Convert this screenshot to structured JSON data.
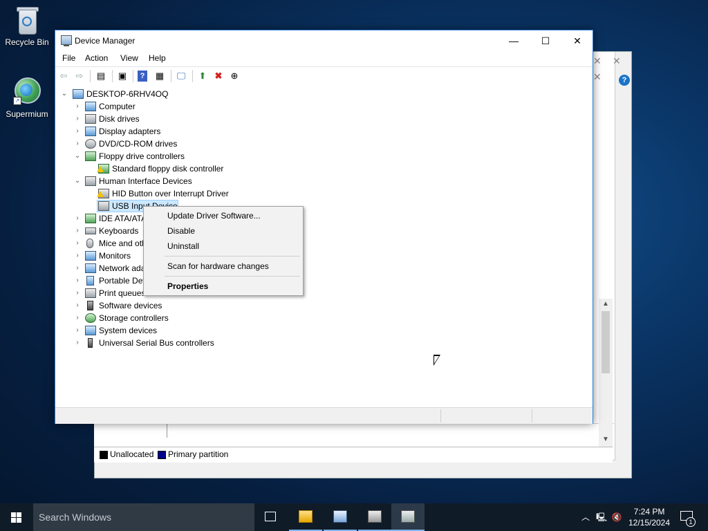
{
  "desktop": {
    "icons": [
      {
        "label": "Recycle Bin",
        "icon": "recycle-bin-icon"
      },
      {
        "label": "Supermium",
        "icon": "supermium-browser-icon"
      }
    ]
  },
  "background_window": {
    "legend": [
      {
        "label": "Unallocated",
        "color": "#000000"
      },
      {
        "label": "Primary partition",
        "color": "#00008b"
      }
    ]
  },
  "device_manager": {
    "title": "Device Manager",
    "controls": {
      "minimize": "—",
      "maximize": "☐",
      "close": "✕"
    },
    "menu": [
      "File",
      "Action",
      "View",
      "Help"
    ],
    "tree": {
      "root": "DESKTOP-6RHV4OQ",
      "categories": [
        {
          "label": "Computer",
          "expanded": false
        },
        {
          "label": "Disk drives",
          "expanded": false
        },
        {
          "label": "Display adapters",
          "expanded": false
        },
        {
          "label": "DVD/CD-ROM drives",
          "expanded": false
        },
        {
          "label": "Floppy drive controllers",
          "expanded": true
        },
        {
          "label": "Standard floppy disk controller",
          "child": true,
          "warning": true
        },
        {
          "label": "Human Interface Devices",
          "expanded": true
        },
        {
          "label": "HID Button over Interrupt Driver",
          "child": true,
          "warning": true
        },
        {
          "label": "USB Input Device",
          "child": true,
          "selected": true
        },
        {
          "label": "IDE ATA/ATAPI controllers",
          "expanded": false
        },
        {
          "label": "Keyboards",
          "expanded": false
        },
        {
          "label": "Mice and other pointing devices",
          "expanded": false
        },
        {
          "label": "Monitors",
          "expanded": false
        },
        {
          "label": "Network adapters",
          "expanded": false
        },
        {
          "label": "Portable Devices",
          "expanded": false
        },
        {
          "label": "Print queues",
          "expanded": false
        },
        {
          "label": "Software devices",
          "expanded": false
        },
        {
          "label": "Storage controllers",
          "expanded": false
        },
        {
          "label": "System devices",
          "expanded": false
        },
        {
          "label": "Universal Serial Bus controllers",
          "expanded": false
        }
      ]
    }
  },
  "context_menu": {
    "items": [
      {
        "label": "Update Driver Software...",
        "bold": false
      },
      {
        "label": "Disable",
        "bold": false
      },
      {
        "label": "Uninstall",
        "bold": false
      },
      {
        "label": "Scan for hardware changes",
        "bold": false
      },
      {
        "label": "Properties",
        "bold": true
      }
    ]
  },
  "taskbar": {
    "search_placeholder": "Search Windows",
    "clock_time": "7:24 PM",
    "clock_date": "12/15/2024",
    "notification_count": "1",
    "accent": "#7cb6f0"
  }
}
